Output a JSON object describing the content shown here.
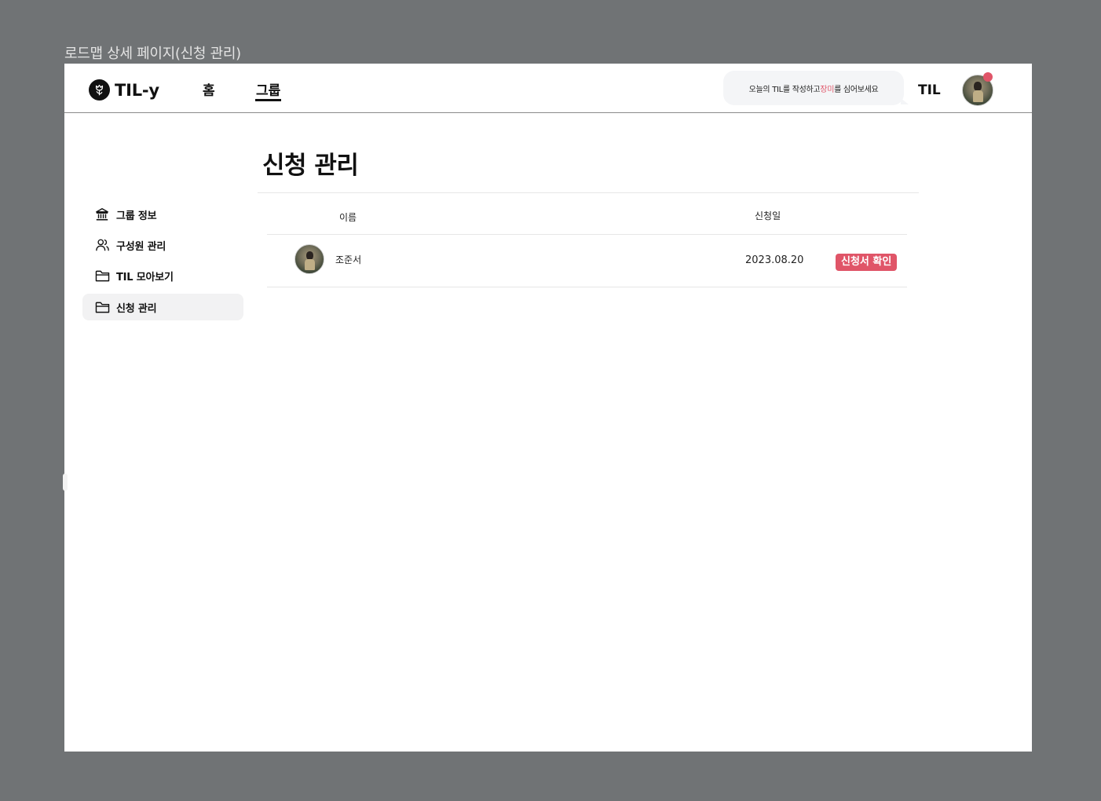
{
  "frame_label": "로드맵 상세 페이지(신청 관리)",
  "header": {
    "logo_text": "TIL-y",
    "nav": [
      {
        "label": "홈",
        "active": false
      },
      {
        "label": "그룹",
        "active": true
      }
    ],
    "bubble": {
      "before": "오늘의 TIL를 작성하고 ",
      "highlight": "장미",
      "after": "를 심어보세요"
    },
    "til_label": "TIL",
    "has_notification": true
  },
  "sidebar": {
    "items": [
      {
        "label": "그룹 정보",
        "icon": "bank-icon",
        "active": false
      },
      {
        "label": "구성원 관리",
        "icon": "users-icon",
        "active": false
      },
      {
        "label": "TIL 모아보기",
        "icon": "folder-icon",
        "active": false
      },
      {
        "label": "신청 관리",
        "icon": "folder-icon",
        "active": true
      }
    ]
  },
  "main": {
    "title": "신청 관리",
    "columns": {
      "name": "이름",
      "date": "신청일"
    },
    "rows": [
      {
        "name": "조준서",
        "date": "2023.08.20",
        "action": "신청서 확인"
      }
    ]
  },
  "colors": {
    "accent": "#e05568",
    "background": "#707375",
    "active_item_bg": "#f2f2f3"
  }
}
